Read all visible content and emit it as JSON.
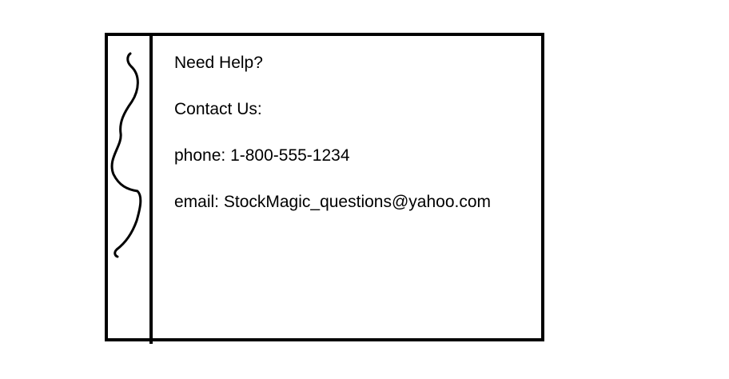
{
  "help_panel": {
    "heading": "Need Help?",
    "contact_label": "Contact Us:",
    "phone_text": "phone: 1-800-555-1234",
    "email_text": "email: StockMagic_questions@yahoo.com"
  },
  "sidebar": {
    "handle_icon": "squiggle-line-icon"
  },
  "colors": {
    "border": "#000000",
    "background": "#ffffff",
    "text": "#000000"
  }
}
